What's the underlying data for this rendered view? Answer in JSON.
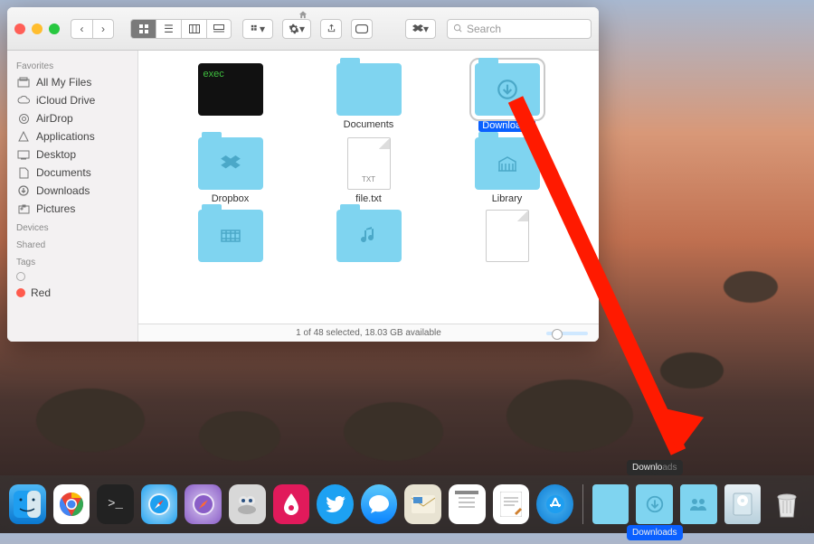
{
  "window": {
    "title_icon": "home",
    "search_placeholder": "Search",
    "status": "1 of 48 selected, 18.03 GB available"
  },
  "sidebar": {
    "sections": [
      {
        "title": "Favorites",
        "items": [
          {
            "icon": "all-files",
            "label": "All My Files"
          },
          {
            "icon": "cloud",
            "label": "iCloud Drive"
          },
          {
            "icon": "airdrop",
            "label": "AirDrop"
          },
          {
            "icon": "apps",
            "label": "Applications"
          },
          {
            "icon": "desktop",
            "label": "Desktop"
          },
          {
            "icon": "documents",
            "label": "Documents"
          },
          {
            "icon": "downloads",
            "label": "Downloads"
          },
          {
            "icon": "pictures",
            "label": "Pictures"
          }
        ]
      },
      {
        "title": "Devices",
        "items": []
      },
      {
        "title": "Shared",
        "items": []
      },
      {
        "title": "Tags",
        "items": [
          {
            "icon": "tag-empty",
            "label": ""
          },
          {
            "icon": "tag-red",
            "label": "Red"
          }
        ]
      }
    ]
  },
  "grid": {
    "items": [
      {
        "kind": "exec",
        "label": "",
        "glyph": "exec"
      },
      {
        "kind": "folder",
        "label": "Documents",
        "glyph": ""
      },
      {
        "kind": "folder",
        "label": "Downloads",
        "glyph": "↓",
        "selected": true
      },
      {
        "kind": "folder",
        "label": "Dropbox",
        "glyph": "dropbox"
      },
      {
        "kind": "file",
        "label": "file.txt",
        "badge": "TXT"
      },
      {
        "kind": "folder",
        "label": "Library",
        "glyph": "library"
      },
      {
        "kind": "folder",
        "label": "",
        "glyph": "movies"
      },
      {
        "kind": "folder",
        "label": "",
        "glyph": "music"
      },
      {
        "kind": "file",
        "label": "",
        "badge": ""
      }
    ]
  },
  "dock": {
    "items": [
      {
        "name": "finder",
        "bg": "#1e9ef0"
      },
      {
        "name": "chrome",
        "bg": "#f2f2f2"
      },
      {
        "name": "terminal",
        "bg": "#111"
      },
      {
        "name": "safari",
        "bg": "#1ea0f0"
      },
      {
        "name": "safari-preview",
        "bg": "#8a5dc7"
      },
      {
        "name": "automator",
        "bg": "#d0d0d0"
      },
      {
        "name": "skitch",
        "bg": "#e11a5b"
      },
      {
        "name": "twitter",
        "bg": "#1da1f2"
      },
      {
        "name": "messages",
        "bg": "#0bbaf5"
      },
      {
        "name": "mail",
        "bg": "#e8e3d2"
      },
      {
        "name": "notes",
        "bg": "#f2f2f2"
      },
      {
        "name": "textedit",
        "bg": "#f2f2f2"
      },
      {
        "name": "appstore",
        "bg": "#1e9ef0"
      }
    ],
    "stacks": [
      {
        "name": "desktop-stack",
        "bg": "#7fd4f0",
        "label": ""
      },
      {
        "name": "downloads-stack",
        "bg": "#7fd4f0",
        "label": "Downloads",
        "tooltip": "Downloads",
        "selected": true
      },
      {
        "name": "shared-stack",
        "bg": "#7fd4f0",
        "label": ""
      },
      {
        "name": "disk",
        "bg": "#d8e8ef",
        "label": ""
      },
      {
        "name": "trash",
        "bg": "#e6e6e6",
        "label": ""
      }
    ]
  }
}
